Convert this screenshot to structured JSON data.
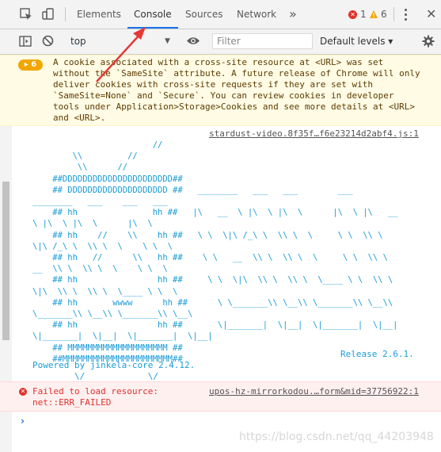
{
  "tabs": {
    "elements": "Elements",
    "console": "Console",
    "sources": "Sources",
    "network": "Network",
    "more": "»",
    "errors_count": "1",
    "warnings_count": "6"
  },
  "toolbar": {
    "context": "top",
    "filter_placeholder": "Filter",
    "levels": "Default levels ▾"
  },
  "warning": {
    "badge": "▸ 6",
    "text": "A cookie associated with a cross-site resource at <URL> was set\nwithout the `SameSite` attribute. A future release of Chrome will only\ndeliver cookies with cross-site requests if they are set with\n`SameSite=None` and `Secure`. You can review cookies in developer\ntools under Application>Storage>Cookies and see more details at <URL>\nand <URL>."
  },
  "log": {
    "source": "stardust-video.8f35f…f6e23214d2abf4.js:1",
    "art": "                        //\n        \\\\         //\n         \\\\      //\n    ##DDDDDDDDDDDDDDDDDDDDDD##\n    ## DDDDDDDDDDDDDDDDDDDD ##   ________   ___   ___        ___\n________   ___    ___   ___\n    ## hh               hh ##   |\\   __  \\ |\\  \\ |\\  \\      |\\  \\ |\\   __\n\\ |\\  \\ |\\  \\      |\\  \\\n    ## hh    //    \\\\    hh ##   \\ \\  \\|\\ /_\\ \\  \\\\ \\  \\     \\ \\  \\\\ \\\n\\|\\ /_\\ \\  \\\\ \\  \\    \\ \\  \\\n    ## hh   //      \\\\   hh ##    \\ \\   __  \\\\ \\  \\\\ \\  \\     \\ \\  \\\\ \\\n__  \\\\ \\  \\\\ \\  \\    \\ \\  \\\n    ## hh                hh ##     \\ \\  \\|\\  \\\\ \\  \\\\ \\  \\____ \\ \\  \\\\ \\\n\\|\\  \\\\ \\  \\\\ \\  \\____ \\ \\  \\\n    ## hh       wwww      hh ##      \\ \\_______\\\\ \\__\\\\ \\_______\\\\ \\__\\\\\n\\_______\\\\ \\__\\\\ \\_______\\\\ \\__\\\n    ## hh                hh ##       \\|_______|  \\|__|  \\|_______|  \\|__|\n\\|_______|  \\|__|  \\|_______|  \\|__|\n    ## MMMMMMMMMMMMMMMMMMMM ##\n    ##MMMMMMMMMMMMMMMMMMMMMM##",
    "release": "Release 2.6.1.",
    "powered": "Powered by jinkela-core 2.4.12.\n        \\/            \\/"
  },
  "error": {
    "text": "Failed to load resource:\nnet::ERR_FAILED",
    "source": "upos-hz-mirrorkodou.…form&mid=37756922:1"
  },
  "prompt": "›",
  "watermark": "https://blog.csdn.net/qq_44203948",
  "colors": {
    "accent": "#1a73e8",
    "error": "#e0312a",
    "warning": "#f2a600",
    "log_text": "#1b9bd7",
    "annotation_arrow": "#e53935"
  }
}
